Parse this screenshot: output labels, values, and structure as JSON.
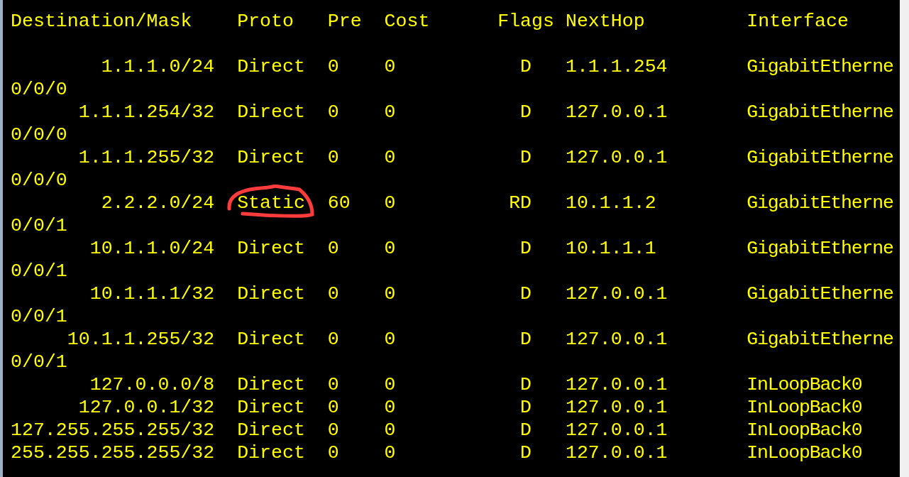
{
  "header": [
    "Destination/Mask",
    "Proto",
    "Pre",
    "Cost",
    "Flags",
    "NextHop",
    "Interface"
  ],
  "rows": [
    {
      "destination": "1.1.1.0/24",
      "proto": "Direct",
      "pre": "0",
      "cost": "0",
      "flags": "D",
      "nexthop": "1.1.1.254",
      "interface": "GigabitEtherne",
      "interface_cont": "0/0/0",
      "circled": false
    },
    {
      "destination": "1.1.1.254/32",
      "proto": "Direct",
      "pre": "0",
      "cost": "0",
      "flags": "D",
      "nexthop": "127.0.0.1",
      "interface": "GigabitEtherne",
      "interface_cont": "0/0/0",
      "circled": false
    },
    {
      "destination": "1.1.1.255/32",
      "proto": "Direct",
      "pre": "0",
      "cost": "0",
      "flags": "D",
      "nexthop": "127.0.0.1",
      "interface": "GigabitEtherne",
      "interface_cont": "0/0/0",
      "circled": false
    },
    {
      "destination": "2.2.2.0/24",
      "proto": "Static",
      "pre": "60",
      "cost": "0",
      "flags": "RD",
      "nexthop": "10.1.1.2",
      "interface": "GigabitEtherne",
      "interface_cont": "0/0/1",
      "circled": true
    },
    {
      "destination": "10.1.1.0/24",
      "proto": "Direct",
      "pre": "0",
      "cost": "0",
      "flags": "D",
      "nexthop": "10.1.1.1",
      "interface": "GigabitEtherne",
      "interface_cont": "0/0/1",
      "circled": false
    },
    {
      "destination": "10.1.1.1/32",
      "proto": "Direct",
      "pre": "0",
      "cost": "0",
      "flags": "D",
      "nexthop": "127.0.0.1",
      "interface": "GigabitEtherne",
      "interface_cont": "0/0/1",
      "circled": false
    },
    {
      "destination": "10.1.1.255/32",
      "proto": "Direct",
      "pre": "0",
      "cost": "0",
      "flags": "D",
      "nexthop": "127.0.0.1",
      "interface": "GigabitEtherne",
      "interface_cont": "0/0/1",
      "circled": false
    },
    {
      "destination": "127.0.0.0/8",
      "proto": "Direct",
      "pre": "0",
      "cost": "0",
      "flags": "D",
      "nexthop": "127.0.0.1",
      "interface": "InLoopBack0",
      "circled": false
    },
    {
      "destination": "127.0.0.1/32",
      "proto": "Direct",
      "pre": "0",
      "cost": "0",
      "flags": "D",
      "nexthop": "127.0.0.1",
      "interface": "InLoopBack0",
      "circled": false
    },
    {
      "destination": "127.255.255.255/32",
      "proto": "Direct",
      "pre": "0",
      "cost": "0",
      "flags": "D",
      "nexthop": "127.0.0.1",
      "interface": "InLoopBack0",
      "circled": false
    },
    {
      "destination": "255.255.255.255/32",
      "proto": "Direct",
      "pre": "0",
      "cost": "0",
      "flags": "D",
      "nexthop": "127.0.0.1",
      "interface": "InLoopBack0",
      "circled": false
    }
  ]
}
